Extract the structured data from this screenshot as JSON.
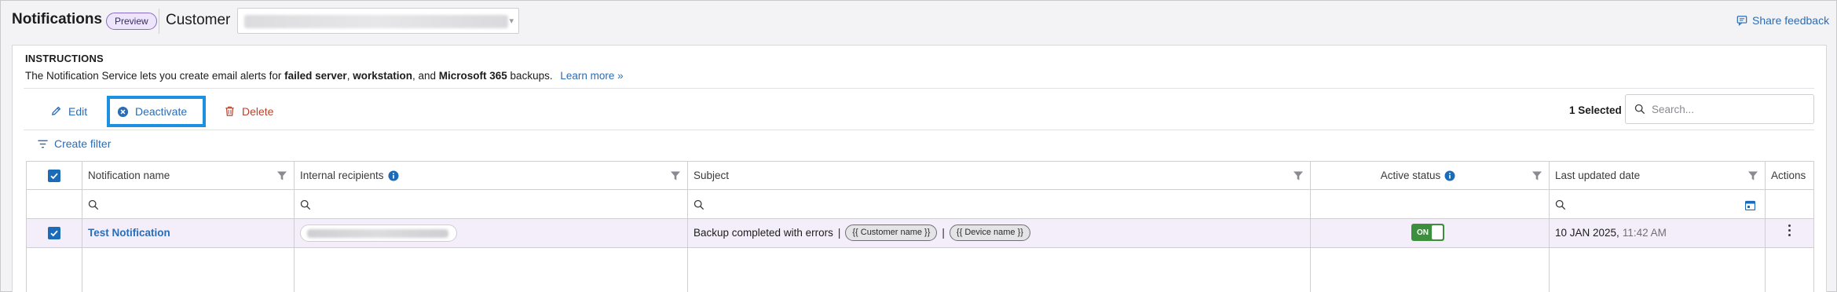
{
  "header": {
    "title": "Notifications",
    "badge": "Preview",
    "customer_label": "Customer",
    "share_feedback": "Share feedback"
  },
  "instructions": {
    "title": "INSTRUCTIONS",
    "text_1": "The Notification Service lets you create email alerts for ",
    "bold_1": "failed server",
    "text_2": ", ",
    "bold_2": "workstation",
    "text_3": ", and ",
    "bold_3": "Microsoft 365",
    "text_4": " backups.",
    "learn_more": "Learn more »"
  },
  "toolbar": {
    "edit": "Edit",
    "deactivate": "Deactivate",
    "delete": "Delete",
    "selected_count": "1 Selected",
    "search_placeholder": "Search..."
  },
  "create_filter": "Create filter",
  "table": {
    "columns": {
      "name": "Notification name",
      "recipients": "Internal recipients",
      "subject": "Subject",
      "active": "Active status",
      "updated": "Last updated date",
      "actions": "Actions"
    },
    "rows": [
      {
        "name": "Test Notification",
        "subject_text": "Backup completed with errors",
        "pipe": "|",
        "token_1": "{{ Customer name }}",
        "token_2": "{{ Device name }}",
        "active": "ON",
        "date": "10 JAN 2025,",
        "time": "11:42 AM"
      }
    ]
  },
  "colors": {
    "accent": "#2a6db5",
    "highlight_border": "#1e90e0",
    "delete": "#b8422c",
    "selected_row": "#f4eefb",
    "toggle_on": "#3c8f3c",
    "badge_bg": "#ede5fb"
  },
  "icons": {
    "share": "comment-icon",
    "edit": "pencil-icon",
    "deactivate": "x-circle-icon",
    "delete": "trash-icon",
    "search": "search-icon",
    "filter": "filter-lines-icon",
    "funnel": "funnel-icon",
    "info": "info-icon",
    "calendar": "calendar-icon",
    "kebab": "kebab-menu-icon"
  }
}
